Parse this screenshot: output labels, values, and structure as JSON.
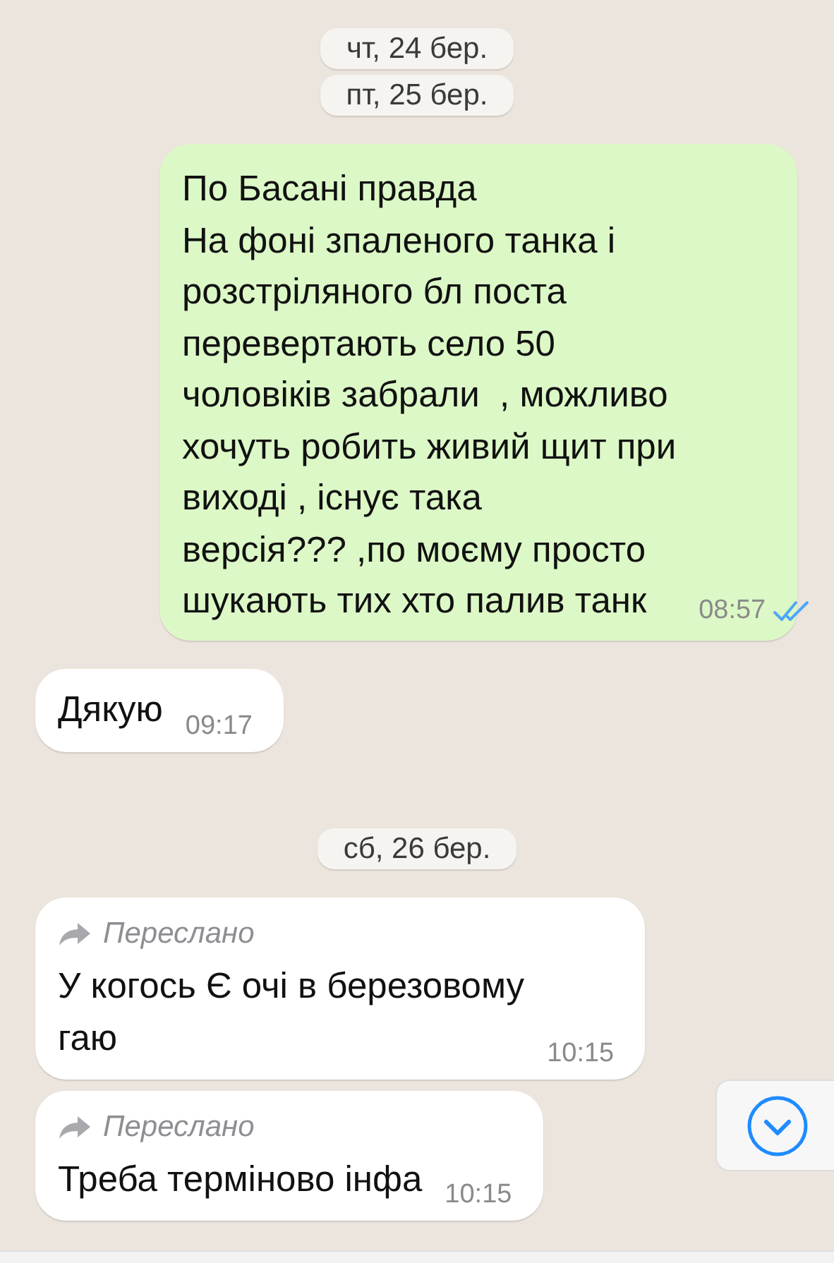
{
  "messages": [
    {
      "kind": "date",
      "text": "чт, 24 бер."
    },
    {
      "kind": "date",
      "text": "пт, 25 бер."
    },
    {
      "kind": "outgoing",
      "text": "По Басані правда\nНа фоні зпаленого танка і\nрозстріляного бл поста\nперевертають село 50\nчоловіків забрали  , можливо\nхочуть робить живий щит при\nвиході , існує така\nверсія??? ,по моєму просто\nшукають тих хто палив танк",
      "time": "08:57",
      "read": true
    },
    {
      "kind": "incoming",
      "text": "Дякую",
      "time": "09:17"
    },
    {
      "kind": "date",
      "text": "сб, 26 бер."
    },
    {
      "kind": "incoming",
      "forwarded": "Переслано",
      "text": "У когось Є очі в березовому\nгаю",
      "time": "10:15"
    },
    {
      "kind": "incoming",
      "forwarded": "Переслано",
      "text": "Треба терміново інфа",
      "time": "10:15"
    }
  ]
}
